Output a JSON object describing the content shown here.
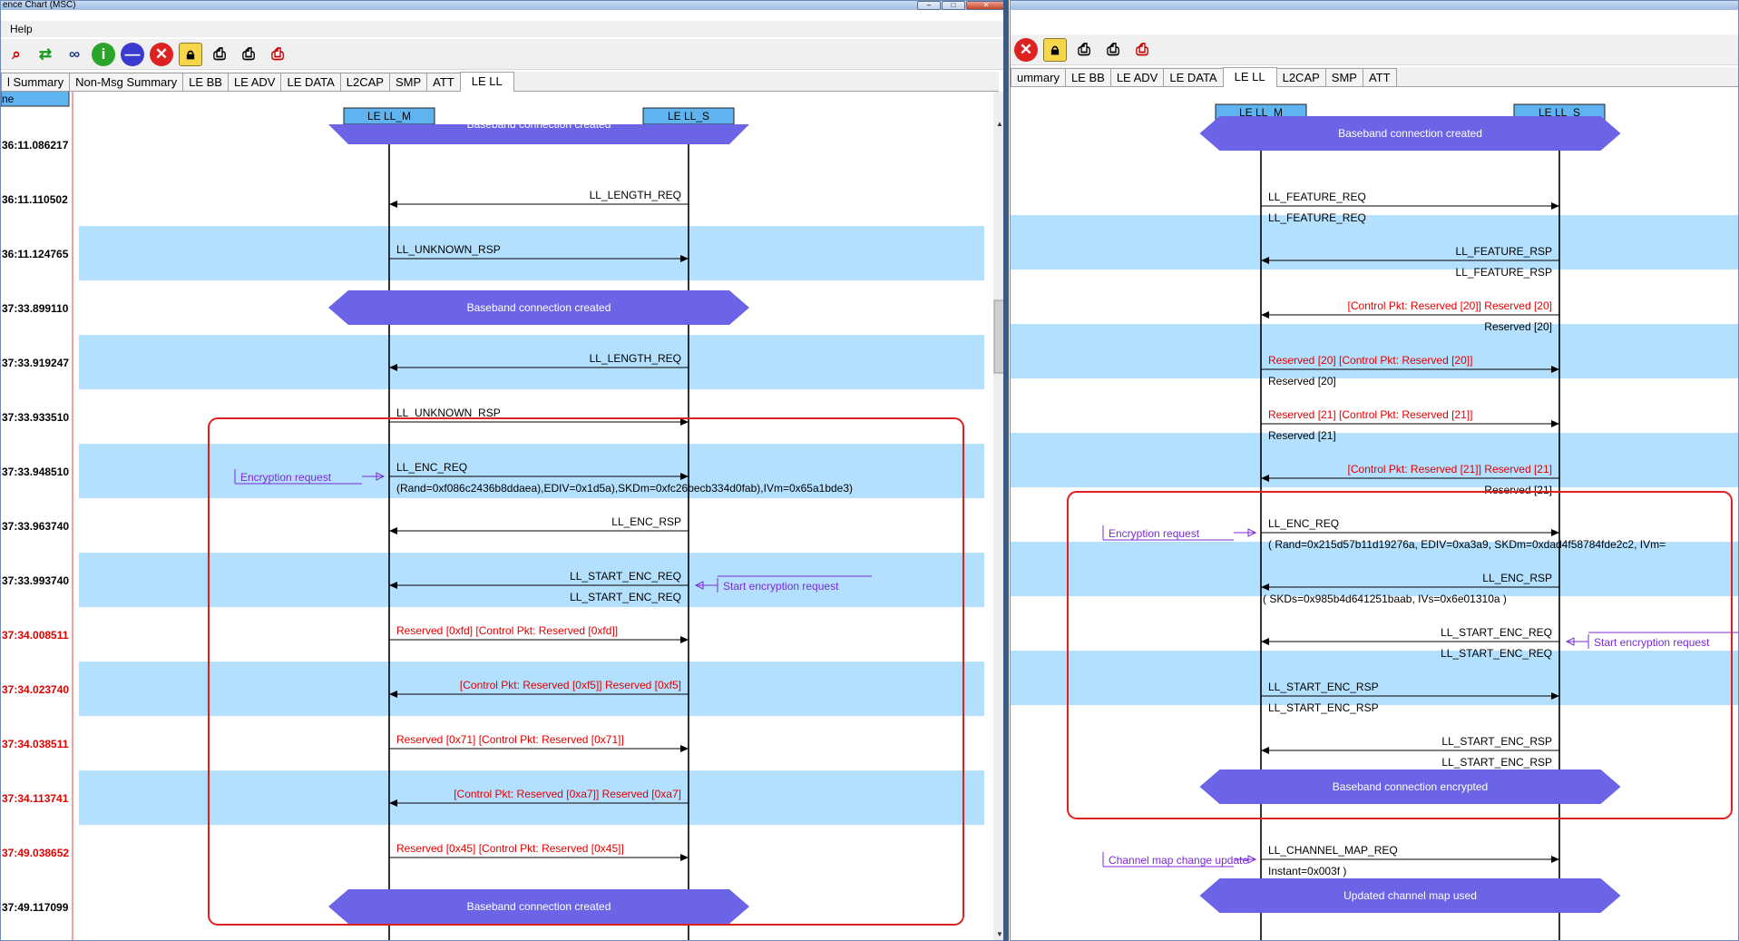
{
  "left_window": {
    "title": "ence Chart (MSC)",
    "menu": [
      "Help"
    ],
    "toolbar_icons": [
      "find-icon",
      "refresh-icon",
      "binoculars-icon",
      "info-icon",
      "stop-icon",
      "cancel-icon",
      "lock-icon",
      "print-preview-icon",
      "print-icon",
      "print-setup-icon"
    ],
    "tabs": [
      "l Summary",
      "Non-Msg Summary",
      "LE BB",
      "LE ADV",
      "LE DATA",
      "L2CAP",
      "SMP",
      "ATT",
      "LE LL"
    ],
    "active_tab": "LE LL",
    "time_header": "ne",
    "lane_left": "LE LL_M",
    "lane_right": "LE LL_S",
    "rows": [
      {
        "time": "36:11.086217",
        "band": false,
        "red_time": false
      },
      {
        "time": "36:11.110502",
        "band": false,
        "red_time": false
      },
      {
        "time": "36:11.124765",
        "band": true,
        "red_time": false
      },
      {
        "time": "37:33.899110",
        "band": false,
        "red_time": false
      },
      {
        "time": "37:33.919247",
        "band": true,
        "red_time": false
      },
      {
        "time": "37:33.933510",
        "band": false,
        "red_time": false
      },
      {
        "time": "37:33.948510",
        "band": true,
        "red_time": false
      },
      {
        "time": "37:33.963740",
        "band": false,
        "red_time": false
      },
      {
        "time": "37:33.993740",
        "band": true,
        "red_time": false
      },
      {
        "time": "37:34.008511",
        "band": false,
        "red_time": true
      },
      {
        "time": "37:34.023740",
        "band": true,
        "red_time": true
      },
      {
        "time": "37:34.038511",
        "band": false,
        "red_time": true
      },
      {
        "time": "37:34.113741",
        "band": true,
        "red_time": true
      },
      {
        "time": "37:49.038652",
        "band": false,
        "red_time": true
      },
      {
        "time": "37:49.117099",
        "band": false,
        "red_time": false
      }
    ],
    "events": [
      {
        "kind": "hex",
        "row": 0,
        "label": "Baseband connection created",
        "partial": true
      },
      {
        "kind": "msg",
        "row": 1,
        "dir": "left",
        "lines": [
          "LL_LENGTH_REQ"
        ],
        "red": false
      },
      {
        "kind": "msg",
        "row": 2,
        "dir": "right",
        "lines": [
          "LL_UNKNOWN_RSP"
        ],
        "red": false
      },
      {
        "kind": "hex",
        "row": 3,
        "label": "Baseband connection created"
      },
      {
        "kind": "msg",
        "row": 4,
        "dir": "left",
        "lines": [
          "LL_LENGTH_REQ"
        ],
        "red": false
      },
      {
        "kind": "msg",
        "row": 5,
        "dir": "right",
        "lines": [
          "LL_UNKNOWN_RSP"
        ],
        "red": false
      },
      {
        "kind": "msg",
        "row": 6,
        "dir": "right",
        "lines": [
          "LL_ENC_REQ",
          "(Rand=0xf086c2436b8ddaea),EDIV=0x1d5a),SKDm=0xfc26becb334d0fab),IVm=0x65a1bde3)"
        ],
        "red": false
      },
      {
        "kind": "msg",
        "row": 7,
        "dir": "left",
        "lines": [
          "LL_ENC_RSP"
        ],
        "red": false
      },
      {
        "kind": "msg",
        "row": 8,
        "dir": "left",
        "lines": [
          "LL_START_ENC_REQ",
          "LL_START_ENC_REQ"
        ],
        "red": false
      },
      {
        "kind": "msg",
        "row": 9,
        "dir": "right",
        "lines": [
          "Reserved [0xfd] [Control Pkt: Reserved [0xfd]]"
        ],
        "red": true
      },
      {
        "kind": "msg",
        "row": 10,
        "dir": "left",
        "lines": [
          "[Control Pkt: Reserved [0xf5]] Reserved [0xf5]"
        ],
        "red": true
      },
      {
        "kind": "msg",
        "row": 11,
        "dir": "right",
        "lines": [
          "Reserved [0x71] [Control Pkt: Reserved [0x71]]"
        ],
        "red": true
      },
      {
        "kind": "msg",
        "row": 12,
        "dir": "left",
        "lines": [
          "[Control Pkt: Reserved [0xa7]] Reserved [0xa7]"
        ],
        "red": true
      },
      {
        "kind": "msg",
        "row": 13,
        "dir": "right",
        "lines": [
          "Reserved [0x45] [Control Pkt: Reserved [0x45]]"
        ],
        "red": true
      },
      {
        "kind": "hex",
        "row": 14,
        "label": "Baseband connection created"
      }
    ],
    "annotations": [
      {
        "row": 6,
        "side": "left",
        "text": "Encryption request"
      },
      {
        "row": 8,
        "side": "right",
        "text": "Start encryption request"
      }
    ]
  },
  "right_window": {
    "toolbar_icons": [
      "cancel-icon",
      "lock-icon",
      "print-preview-icon",
      "print-icon",
      "print-setup-icon"
    ],
    "tabs": [
      "ummary",
      "LE BB",
      "LE ADV",
      "LE DATA",
      "LE LL",
      "L2CAP",
      "SMP",
      "ATT"
    ],
    "active_tab": "LE LL",
    "lane_left": "LE LL_M",
    "lane_right": "LE LL_S",
    "rows": [
      {
        "band": false
      },
      {
        "band": false
      },
      {
        "band": true
      },
      {
        "band": false
      },
      {
        "band": true
      },
      {
        "band": false
      },
      {
        "band": true
      },
      {
        "band": false
      },
      {
        "band": true
      },
      {
        "band": false
      },
      {
        "band": true
      },
      {
        "band": false
      },
      {
        "band": false
      },
      {
        "band": false
      },
      {
        "band": false
      }
    ],
    "events": [
      {
        "kind": "hex",
        "row": 0,
        "label": "Baseband connection created"
      },
      {
        "kind": "msg",
        "row": 1,
        "dir": "right",
        "lines": [
          "LL_FEATURE_REQ",
          "LL_FEATURE_REQ"
        ],
        "red": false
      },
      {
        "kind": "msg",
        "row": 2,
        "dir": "left",
        "lines": [
          "LL_FEATURE_RSP",
          "LL_FEATURE_RSP"
        ],
        "red": false
      },
      {
        "kind": "msg",
        "row": 3,
        "dir": "left",
        "lines": [
          "[Control Pkt: Reserved [20]] Reserved [20]",
          "Reserved [20]"
        ],
        "red": true,
        "red_second": false
      },
      {
        "kind": "msg",
        "row": 4,
        "dir": "right",
        "lines": [
          "Reserved [20] [Control Pkt: Reserved [20]]",
          "Reserved [20]"
        ],
        "red": true,
        "red_second": false
      },
      {
        "kind": "msg",
        "row": 5,
        "dir": "right",
        "lines": [
          "Reserved [21] [Control Pkt: Reserved [21]]",
          "Reserved [21]"
        ],
        "red": true,
        "red_second": false
      },
      {
        "kind": "msg",
        "row": 6,
        "dir": "left",
        "lines": [
          "[Control Pkt: Reserved [21]] Reserved [21]",
          "Reserved [21]"
        ],
        "red": true,
        "red_second": false
      },
      {
        "kind": "msg",
        "row": 7,
        "dir": "right",
        "lines": [
          "LL_ENC_REQ",
          "( Rand=0x215d57b11d19276a, EDIV=0xa3a9, SKDm=0xdad4f58784fde2c2, IVm="
        ],
        "red": false
      },
      {
        "kind": "msg",
        "row": 8,
        "dir": "left",
        "lines": [
          "LL_ENC_RSP",
          "( SKDs=0x985b4d641251baab, IVs=0x6e01310a )"
        ],
        "red": false
      },
      {
        "kind": "msg",
        "row": 9,
        "dir": "left",
        "lines": [
          "LL_START_ENC_REQ",
          "LL_START_ENC_REQ"
        ],
        "red": false
      },
      {
        "kind": "msg",
        "row": 10,
        "dir": "right",
        "lines": [
          "LL_START_ENC_RSP",
          "LL_START_ENC_RSP"
        ],
        "red": false
      },
      {
        "kind": "msg",
        "row": 11,
        "dir": "left",
        "lines": [
          "LL_START_ENC_RSP",
          "LL_START_ENC_RSP"
        ],
        "red": false
      },
      {
        "kind": "hex",
        "row": 12,
        "label": "Baseband connection encrypted"
      },
      {
        "kind": "msg",
        "row": 13,
        "dir": "right",
        "lines": [
          "LL_CHANNEL_MAP_REQ",
          "Instant=0x003f )"
        ],
        "red": false
      },
      {
        "kind": "hex",
        "row": 14,
        "label": "Updated channel map used"
      }
    ],
    "annotations": [
      {
        "row": 7,
        "side": "left",
        "text": "Encryption request"
      },
      {
        "row": 9,
        "side": "right",
        "text": "Start encryption request"
      },
      {
        "row": 13,
        "side": "left",
        "text": "Channel map change update"
      }
    ]
  },
  "colors": {
    "band": "#b3e0ff",
    "hex_fill": "#6b64e6",
    "lane_box": "#5fb3ef",
    "annotation": "#7a2bd6",
    "reserved_red": "#e10000",
    "highlight_box": "#e02020"
  }
}
